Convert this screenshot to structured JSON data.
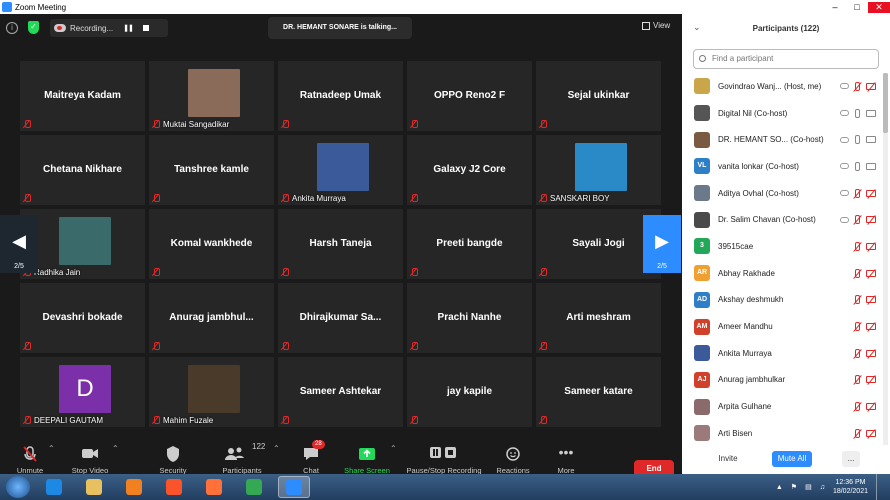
{
  "window": {
    "title": "Zoom Meeting"
  },
  "topbar": {
    "recording_label": "Recording...",
    "talking": "DR. HEMANT SONARE is talking...",
    "view_label": "View"
  },
  "gallery": {
    "page_left": "2/5",
    "page_right": "2/5",
    "tiles": [
      {
        "name": "Maitreya Kadam",
        "photo": false
      },
      {
        "name": "Muktai Sangadikar",
        "photo": true,
        "color": "#8a6a58"
      },
      {
        "name": "Ratnadeep Umak",
        "photo": false
      },
      {
        "name": "OPPO Reno2 F",
        "photo": false
      },
      {
        "name": "Sejal ukinkar",
        "photo": false
      },
      {
        "name": "Chetana Nikhare",
        "photo": false
      },
      {
        "name": "Tanshree kamle",
        "photo": false
      },
      {
        "name": "Ankita Murraya",
        "photo": true,
        "color": "#3a5a9a"
      },
      {
        "name": "Galaxy J2 Core",
        "photo": false
      },
      {
        "name": "SANSKARI BOY",
        "photo": true,
        "color": "#2a8ac8"
      },
      {
        "name": "Radhika Jain",
        "photo": true,
        "color": "#3a6a6a"
      },
      {
        "name": "Komal wankhede",
        "photo": false
      },
      {
        "name": "Harsh Taneja",
        "photo": false
      },
      {
        "name": "Preeti bangde",
        "photo": false
      },
      {
        "name": "Sayali Jogi",
        "photo": false
      },
      {
        "name": "Devashri bokade",
        "photo": false
      },
      {
        "name": "Anurag  jambhul...",
        "photo": false
      },
      {
        "name": "Dhirajkumar  Sa...",
        "photo": false
      },
      {
        "name": "Prachi Nanhe",
        "photo": false
      },
      {
        "name": "Arti meshram",
        "photo": false
      },
      {
        "name": "DEEPALI GAUTAM",
        "photo": true,
        "initial": "D",
        "color": "#7b2fa8"
      },
      {
        "name": "Mahim Fuzale",
        "photo": true,
        "color": "#4a3a2a"
      },
      {
        "name": "Sameer Ashtekar",
        "photo": false
      },
      {
        "name": "jay kapile",
        "photo": false
      },
      {
        "name": "Sameer katare",
        "photo": false
      }
    ]
  },
  "toolbar": {
    "unmute": "Unmute",
    "stop_video": "Stop Video",
    "security": "Security",
    "participants": "Participants",
    "participants_count": "122",
    "chat": "Chat",
    "chat_badge": "28",
    "share_screen": "Share Screen",
    "pause_stop_recording": "Pause/Stop Recording",
    "reactions": "Reactions",
    "more": "More",
    "end": "End"
  },
  "panel": {
    "title": "Participants (122)",
    "search_placeholder": "Find a participant",
    "participants": [
      {
        "name": "Govindrao Wanj... (Host, me)",
        "initials": "",
        "color": "#c9a64a",
        "mic": "off",
        "video": "off",
        "cloud": true
      },
      {
        "name": "Digital Nil (Co-host)",
        "initials": "",
        "color": "#555555",
        "mic": "on",
        "video": "on",
        "cloud": true
      },
      {
        "name": "DR. HEMANT SO...  (Co-host)",
        "initials": "",
        "color": "#7a5a40",
        "mic": "on",
        "video": "on",
        "cloud": true
      },
      {
        "name": "vanita lonkar (Co-host)",
        "initials": "VL",
        "color": "#2d7fc8",
        "mic": "on",
        "video": "on",
        "cloud": true
      },
      {
        "name": "Aditya Ovhal (Co-host)",
        "initials": "",
        "color": "#6a7a8a",
        "mic": "off",
        "video": "off",
        "cloud": true
      },
      {
        "name": "Dr. Salim Chavan (Co-host)",
        "initials": "",
        "color": "#4a4a4a",
        "mic": "off",
        "video": "off",
        "cloud": true
      },
      {
        "name": "39515cae",
        "initials": "3",
        "color": "#23a85a",
        "mic": "off",
        "video": "off",
        "cloud": false
      },
      {
        "name": "Abhay Rakhade",
        "initials": "AR",
        "color": "#f0a030",
        "mic": "off",
        "video": "off",
        "cloud": false
      },
      {
        "name": "Akshay deshmukh",
        "initials": "AD",
        "color": "#2d7fc8",
        "mic": "off",
        "video": "off",
        "cloud": false
      },
      {
        "name": "Ameer Mandhu",
        "initials": "AM",
        "color": "#d0402a",
        "mic": "off",
        "video": "off",
        "cloud": false
      },
      {
        "name": "Ankita Murraya",
        "initials": "",
        "color": "#3a5a9a",
        "mic": "off",
        "video": "off",
        "cloud": false
      },
      {
        "name": "Anurag jambhulkar",
        "initials": "AJ",
        "color": "#d0402a",
        "mic": "off",
        "video": "off",
        "cloud": false
      },
      {
        "name": "Arpita Gulhane",
        "initials": "",
        "color": "#8a6a6a",
        "mic": "off",
        "video": "off",
        "cloud": false
      },
      {
        "name": "Arti Bisen",
        "initials": "",
        "color": "#9a7a7a",
        "mic": "off",
        "video": "off",
        "cloud": false
      }
    ],
    "invite": "Invite",
    "mute_all": "Mute All",
    "more": "..."
  },
  "taskbar": {
    "time": "12:36 PM",
    "date": "18/02/2021",
    "apps": [
      {
        "name": "ie-icon",
        "color": "#1e88e5"
      },
      {
        "name": "folder-icon",
        "color": "#e8c060"
      },
      {
        "name": "media-player-icon",
        "color": "#f08020"
      },
      {
        "name": "brave-icon",
        "color": "#fb542b"
      },
      {
        "name": "firefox-icon",
        "color": "#ff7139"
      },
      {
        "name": "chrome-icon",
        "color": "#34a853"
      },
      {
        "name": "zoom-icon",
        "color": "#2d8cff"
      }
    ]
  }
}
